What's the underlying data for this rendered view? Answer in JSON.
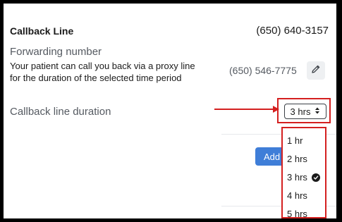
{
  "callback": {
    "label": "Callback Line",
    "number": "(650) 640-3157"
  },
  "forwarding": {
    "label": "Forwarding number",
    "description": "Your patient can call you back via a proxy line for the duration of the selected time period",
    "number": "(650) 546-7775",
    "edit_icon": "pencil-icon"
  },
  "duration": {
    "label": "Callback line duration",
    "selected": "3 hrs",
    "options": [
      "1 hr",
      "2 hrs",
      "3 hrs",
      "4 hrs",
      "5 hrs"
    ]
  },
  "add_button": {
    "label": "Add"
  },
  "colors": {
    "highlight": "#d42020",
    "accent": "#3f7ed8"
  }
}
